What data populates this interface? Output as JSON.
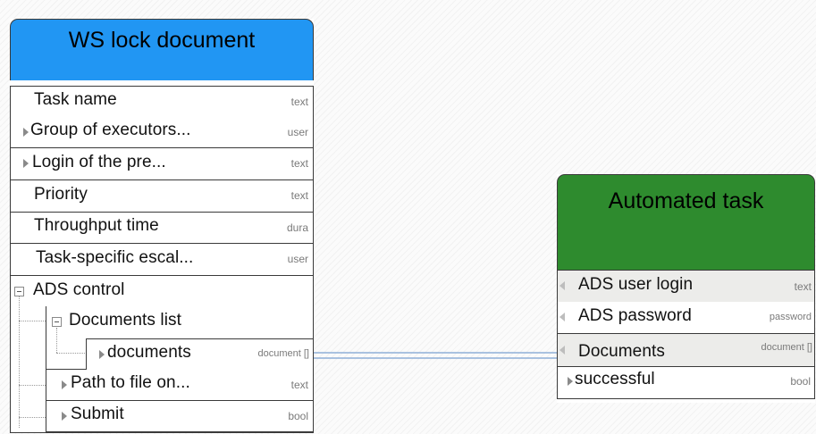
{
  "colors": {
    "ws_header": "#2196f3",
    "auto_header": "#2e8b2e",
    "connector": "#8fb0d8"
  },
  "ws_node": {
    "title": "WS lock document",
    "rows": [
      {
        "label": "Task name",
        "type": "text"
      },
      {
        "label": "Group of executors...",
        "type": "user"
      },
      {
        "label": "Login of the pre...",
        "type": "text"
      },
      {
        "label": "Priority",
        "type": "text"
      },
      {
        "label": "Throughput time",
        "type": "dura"
      },
      {
        "label": "Task-specific escal...",
        "type": "user"
      },
      {
        "label": "ADS control",
        "type": ""
      },
      {
        "label": "Documents list",
        "type": ""
      },
      {
        "label": "documents",
        "type": "document []"
      },
      {
        "label": "Path to file on...",
        "type": "text"
      },
      {
        "label": "Submit",
        "type": "bool"
      }
    ]
  },
  "auto_node": {
    "title": "Automated task",
    "rows": [
      {
        "label": "ADS user login",
        "type": "text"
      },
      {
        "label": "ADS password",
        "type": "password"
      },
      {
        "label": "Documents",
        "type": "document []"
      },
      {
        "label": "successful",
        "type": "bool"
      }
    ]
  }
}
